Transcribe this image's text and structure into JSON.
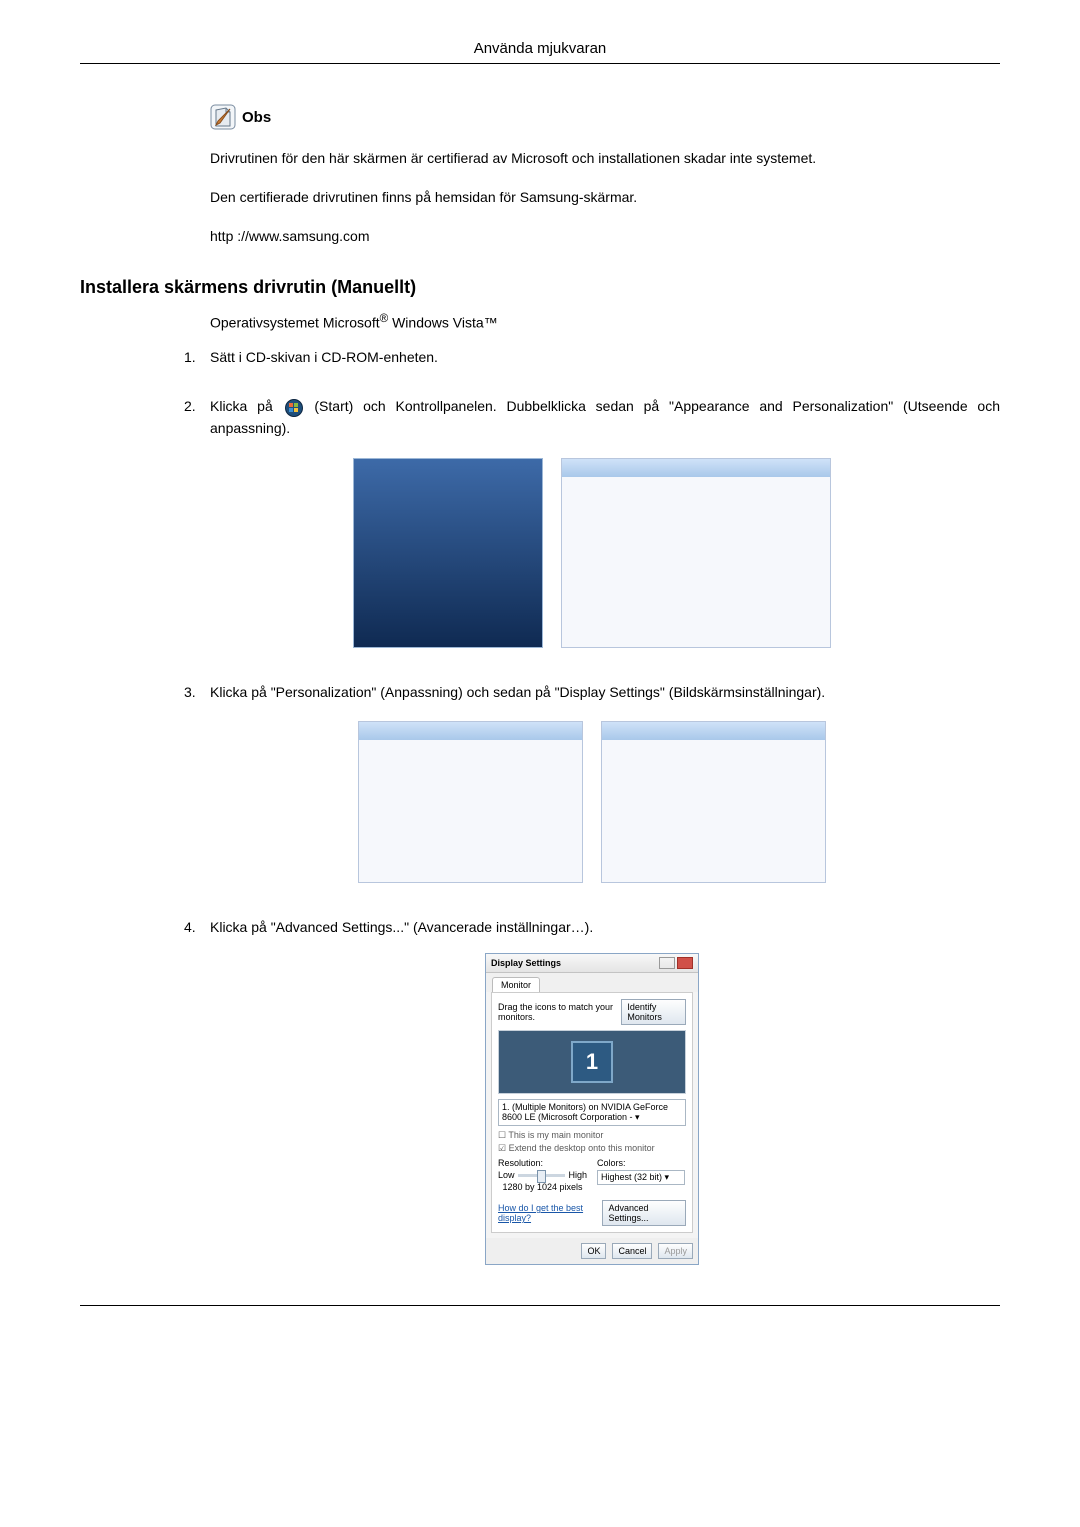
{
  "header": {
    "title": "Använda mjukvaran"
  },
  "obs": {
    "label": "Obs"
  },
  "intro": {
    "p1": "Drivrutinen för den här skärmen är certifierad av Microsoft och installationen skadar inte systemet.",
    "p2": "Den certifierade drivrutinen finns på hemsidan för Samsung-skärmar.",
    "p3": "http ://www.samsung.com"
  },
  "section": {
    "title": "Installera skärmens drivrutin (Manuellt)"
  },
  "os_line": {
    "prefix": "Operativsystemet Microsoft",
    "reg": "®",
    "suffix": " Windows Vista™"
  },
  "steps": {
    "s1": {
      "num": "1.",
      "text": "Sätt i CD-skivan i CD-ROM-enheten."
    },
    "s2": {
      "num": "2.",
      "before": "Klicka på ",
      "after": " (Start) och Kontrollpanelen. Dubbelklicka sedan på \"Appearance and Personalization\" (Utseende och anpassning)."
    },
    "s3": {
      "num": "3.",
      "text": "Klicka på \"Personalization\" (Anpassning) och sedan på \"Display Settings\" (Bildskärmsinställningar)."
    },
    "s4": {
      "num": "4.",
      "text": "Klicka på \"Advanced Settings...\" (Avancerade inställningar…)."
    }
  },
  "display_settings": {
    "title": "Display Settings",
    "tab": "Monitor",
    "drag_text": "Drag the icons to match your monitors.",
    "identify_btn": "Identify Monitors",
    "monitor_num": "1",
    "select_text": "1. (Multiple Monitors) on NVIDIA GeForce 8600 LE (Microsoft Corporation - ▾",
    "check1": "This is my main monitor",
    "check2": "Extend the desktop onto this monitor",
    "res_label": "Resolution:",
    "low": "Low",
    "high": "High",
    "res_value": "1280 by 1024 pixels",
    "colors_label": "Colors:",
    "colors_value": "Highest (32 bit)    ▾",
    "help_link": "How do I get the best display?",
    "advanced_btn": "Advanced Settings...",
    "ok": "OK",
    "cancel": "Cancel",
    "apply": "Apply"
  }
}
